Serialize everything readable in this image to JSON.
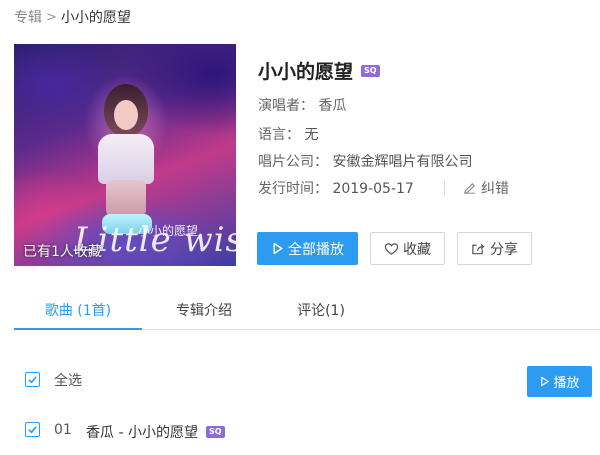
{
  "breadcrumb": {
    "root": "专辑",
    "separator": ">",
    "current": "小小的愿望"
  },
  "album": {
    "title": "小小的愿望",
    "quality_badge": "SQ",
    "cover_script_text": "Little wish",
    "cover_cn_text": "小小的愿望",
    "collect_count": "已有1人收藏"
  },
  "info": {
    "artist_label": "演唱者：",
    "artist": "香瓜",
    "language_label": "语言：",
    "language": "无",
    "company_label": "唱片公司：",
    "company": "安徽金辉唱片有限公司",
    "release_label": "发行时间：",
    "release_date": "2019-05-17",
    "report_label": "纠错"
  },
  "actions": {
    "play_all": "全部播放",
    "collect": "收藏",
    "share": "分享"
  },
  "tabs": [
    {
      "label": "歌曲 (1首)",
      "active": true
    },
    {
      "label": "专辑介绍",
      "active": false
    },
    {
      "label": "评论(1)",
      "active": false
    }
  ],
  "list": {
    "select_all_label": "全选",
    "play_button": "播放",
    "songs": [
      {
        "number": "01",
        "title": "香瓜 - 小小的愿望",
        "badge": "SQ",
        "checked": true
      }
    ]
  },
  "colors": {
    "accent": "#2d9cf0",
    "sq_badge": "#8e6bd9"
  }
}
